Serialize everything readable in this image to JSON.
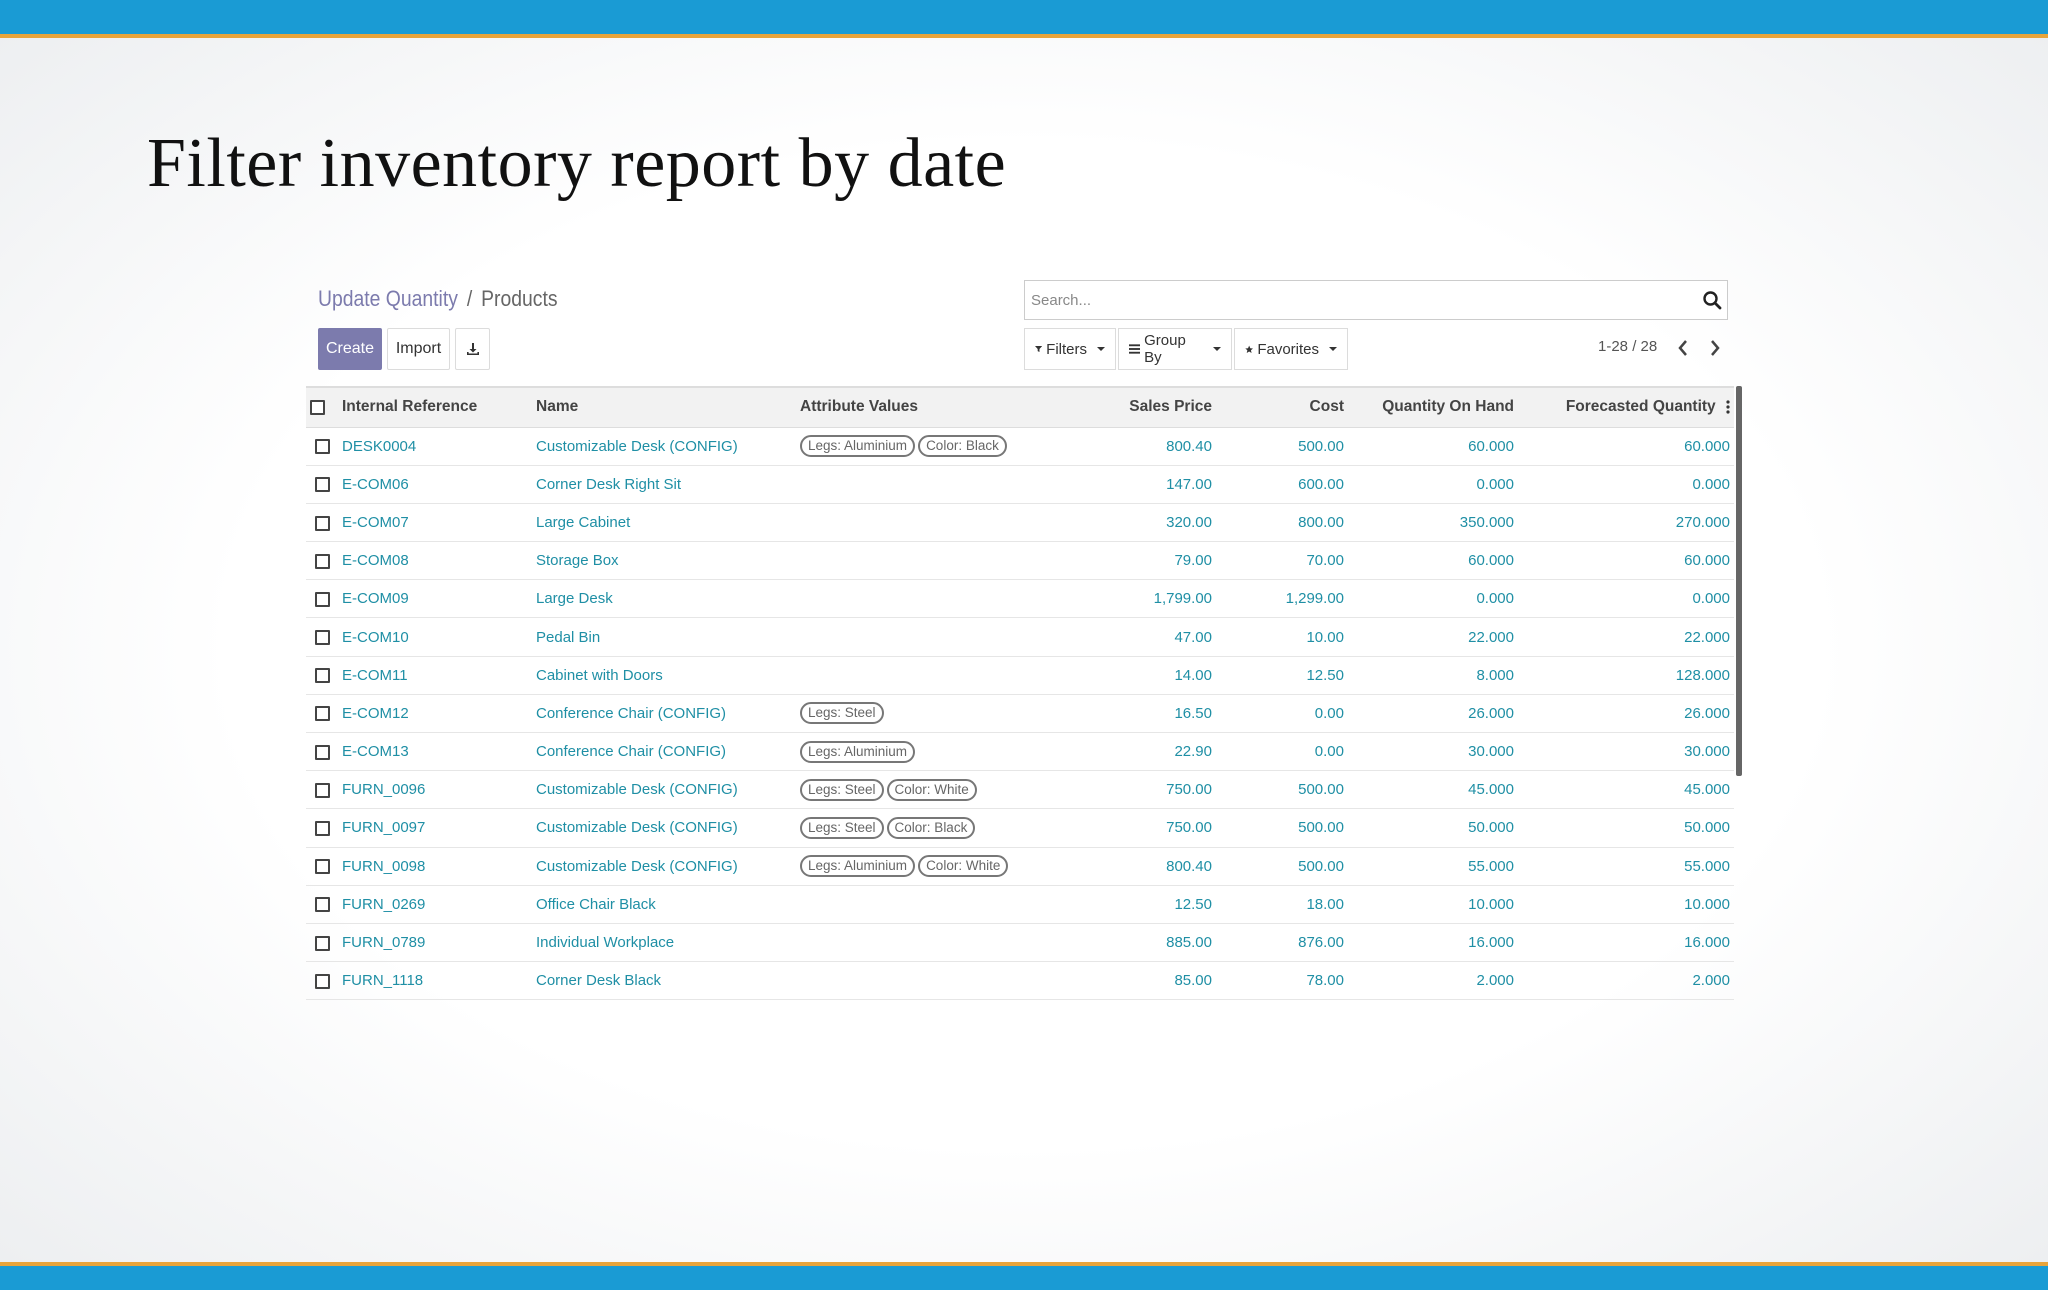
{
  "slide": {
    "title": "Filter inventory report by date"
  },
  "breadcrumb": {
    "parent": "Update Quantity",
    "separator": "/",
    "current": "Products"
  },
  "toolbar": {
    "create_label": "Create",
    "import_label": "Import",
    "download_icon": "download-icon"
  },
  "search": {
    "placeholder": "Search..."
  },
  "filters": {
    "filters_label": "Filters",
    "groupby_label": "Group By",
    "favorites_label": "Favorites"
  },
  "pager": {
    "label": "1-28 / 28"
  },
  "colors": {
    "accent": "#7c7bad",
    "link": "#1f8fa5",
    "top_bar": "#1a9bd4",
    "stripe": "#e8a43a"
  },
  "table": {
    "columns": [
      "Internal Reference",
      "Name",
      "Attribute Values",
      "Sales Price",
      "Cost",
      "Quantity On Hand",
      "Forecasted Quantity"
    ],
    "rows": [
      {
        "ref": "DESK0004",
        "name": "Customizable Desk (CONFIG)",
        "tags": [
          "Legs: Aluminium",
          "Color: Black"
        ],
        "price": "800.40",
        "cost": "500.00",
        "onhand": "60.000",
        "forecast": "60.000"
      },
      {
        "ref": "E-COM06",
        "name": "Corner Desk Right Sit",
        "tags": [],
        "price": "147.00",
        "cost": "600.00",
        "onhand": "0.000",
        "forecast": "0.000"
      },
      {
        "ref": "E-COM07",
        "name": "Large Cabinet",
        "tags": [],
        "price": "320.00",
        "cost": "800.00",
        "onhand": "350.000",
        "forecast": "270.000"
      },
      {
        "ref": "E-COM08",
        "name": "Storage Box",
        "tags": [],
        "price": "79.00",
        "cost": "70.00",
        "onhand": "60.000",
        "forecast": "60.000"
      },
      {
        "ref": "E-COM09",
        "name": "Large Desk",
        "tags": [],
        "price": "1,799.00",
        "cost": "1,299.00",
        "onhand": "0.000",
        "forecast": "0.000"
      },
      {
        "ref": "E-COM10",
        "name": "Pedal Bin",
        "tags": [],
        "price": "47.00",
        "cost": "10.00",
        "onhand": "22.000",
        "forecast": "22.000"
      },
      {
        "ref": "E-COM11",
        "name": "Cabinet with Doors",
        "tags": [],
        "price": "14.00",
        "cost": "12.50",
        "onhand": "8.000",
        "forecast": "128.000"
      },
      {
        "ref": "E-COM12",
        "name": "Conference Chair (CONFIG)",
        "tags": [
          "Legs: Steel"
        ],
        "price": "16.50",
        "cost": "0.00",
        "onhand": "26.000",
        "forecast": "26.000"
      },
      {
        "ref": "E-COM13",
        "name": "Conference Chair (CONFIG)",
        "tags": [
          "Legs: Aluminium"
        ],
        "price": "22.90",
        "cost": "0.00",
        "onhand": "30.000",
        "forecast": "30.000"
      },
      {
        "ref": "FURN_0096",
        "name": "Customizable Desk (CONFIG)",
        "tags": [
          "Legs: Steel",
          "Color: White"
        ],
        "price": "750.00",
        "cost": "500.00",
        "onhand": "45.000",
        "forecast": "45.000"
      },
      {
        "ref": "FURN_0097",
        "name": "Customizable Desk (CONFIG)",
        "tags": [
          "Legs: Steel",
          "Color: Black"
        ],
        "price": "750.00",
        "cost": "500.00",
        "onhand": "50.000",
        "forecast": "50.000"
      },
      {
        "ref": "FURN_0098",
        "name": "Customizable Desk (CONFIG)",
        "tags": [
          "Legs: Aluminium",
          "Color: White"
        ],
        "price": "800.40",
        "cost": "500.00",
        "onhand": "55.000",
        "forecast": "55.000"
      },
      {
        "ref": "FURN_0269",
        "name": "Office Chair Black",
        "tags": [],
        "price": "12.50",
        "cost": "18.00",
        "onhand": "10.000",
        "forecast": "10.000"
      },
      {
        "ref": "FURN_0789",
        "name": "Individual Workplace",
        "tags": [],
        "price": "885.00",
        "cost": "876.00",
        "onhand": "16.000",
        "forecast": "16.000"
      },
      {
        "ref": "FURN_1118",
        "name": "Corner Desk Black",
        "tags": [],
        "price": "85.00",
        "cost": "78.00",
        "onhand": "2.000",
        "forecast": "2.000"
      }
    ]
  }
}
